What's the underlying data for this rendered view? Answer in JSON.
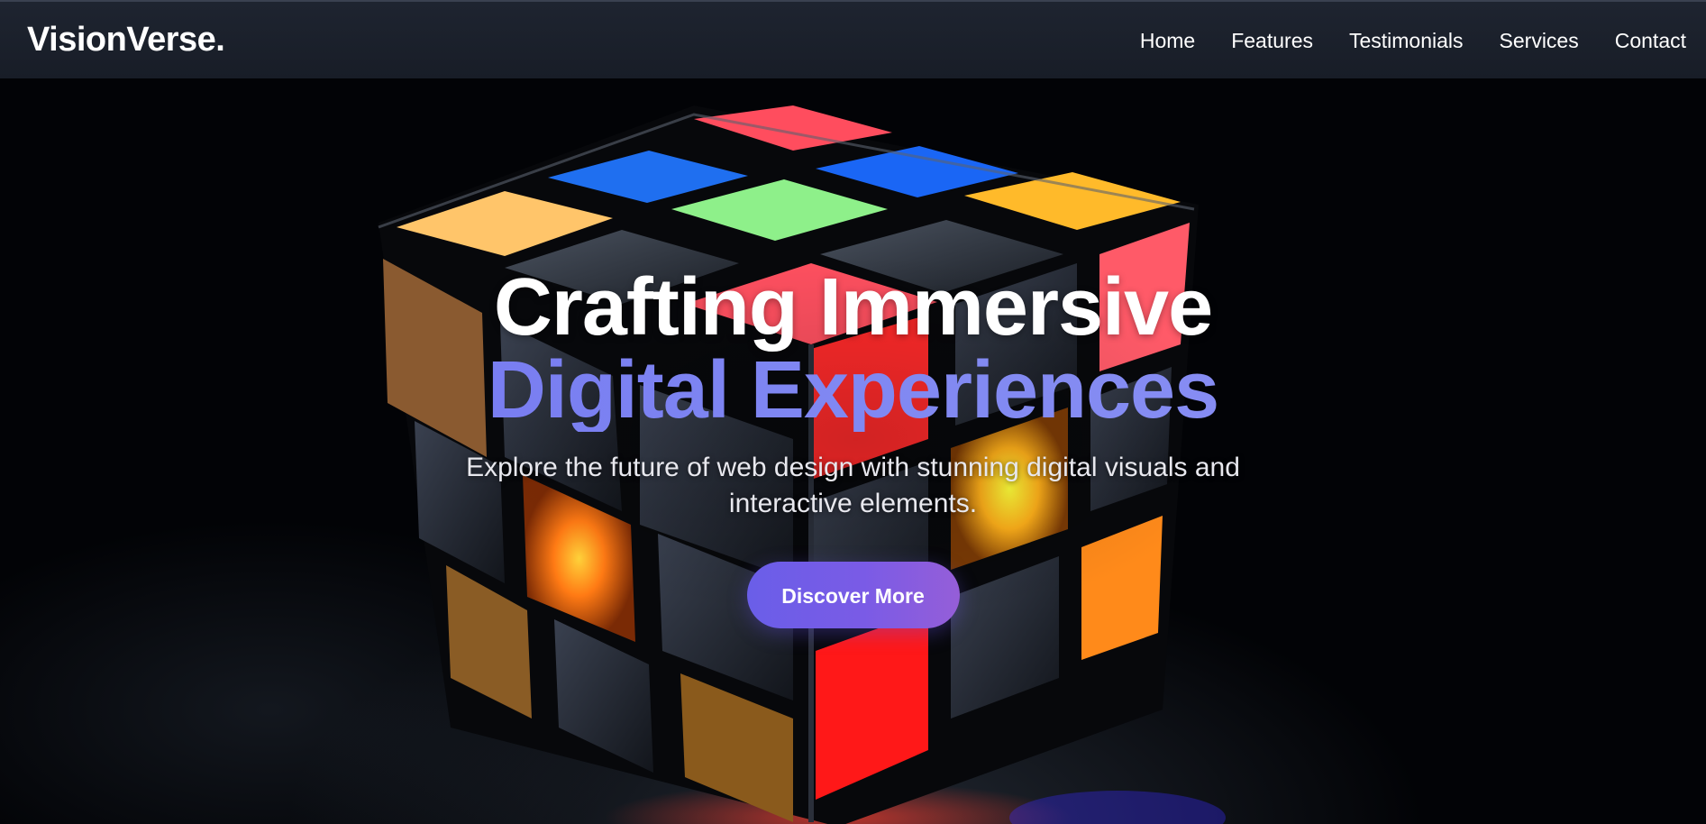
{
  "brand": {
    "logo_text": "VisionVerse."
  },
  "nav": {
    "items": [
      {
        "label": "Home"
      },
      {
        "label": "Features"
      },
      {
        "label": "Testimonials"
      },
      {
        "label": "Services"
      },
      {
        "label": "Contact"
      }
    ]
  },
  "hero": {
    "title_line_1": "Crafting Immersive",
    "title_line_2": "Digital Experiences",
    "subtitle": "Explore the future of web design with stunning digital visuals and interactive elements.",
    "cta_label": "Discover More",
    "background_image": "rubiks-cube-illustration"
  },
  "colors": {
    "header_bg": "#1b202b",
    "hero_bg": "#020306",
    "title_accent": "#7b80f0",
    "cta_start": "#6a5ee8",
    "cta_end": "#955ed8",
    "text_light": "#ffffff"
  }
}
